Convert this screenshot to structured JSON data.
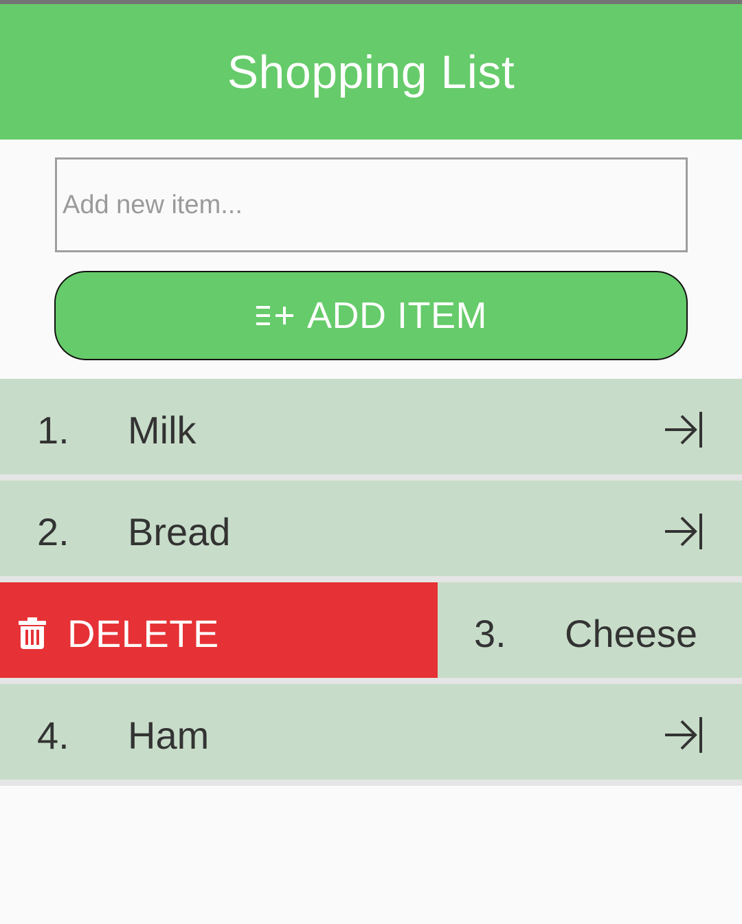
{
  "header": {
    "title": "Shopping List"
  },
  "form": {
    "input_placeholder": "Add new item...",
    "input_value": "",
    "add_button_label": "ADD ITEM"
  },
  "list": {
    "items": [
      {
        "number": "1.",
        "label": "Milk"
      },
      {
        "number": "2.",
        "label": "Bread"
      },
      {
        "number": "3.",
        "label": "Cheese",
        "swipe_action": "DELETE"
      },
      {
        "number": "4.",
        "label": "Ham"
      }
    ]
  },
  "colors": {
    "header": "#66cb6a",
    "button": "#66cb6a",
    "row": "#c8ddc9",
    "delete": "#e63236",
    "text": "#333333"
  }
}
